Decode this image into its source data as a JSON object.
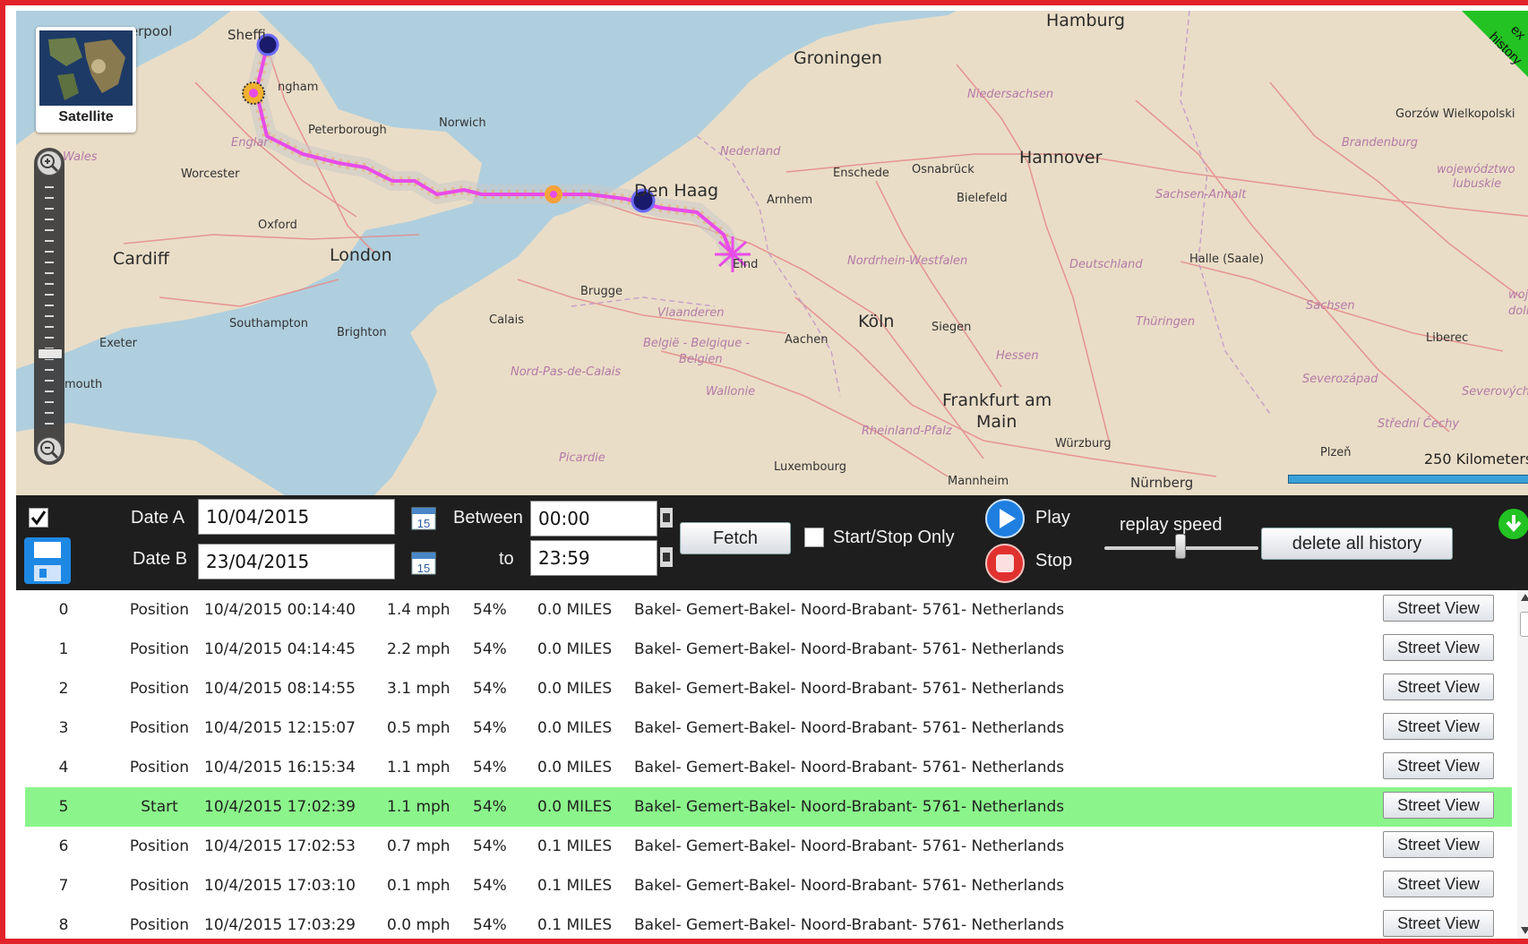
{
  "colors": {
    "frame_border": "#e2232a",
    "route_line": "#e84ce8",
    "toolbar_bg": "#1e1e1e",
    "highlight_row": "#8bf58b",
    "ribbon_green": "#22c322",
    "play_blue": "#1e7fe0",
    "stop_red": "#e0312f"
  },
  "map": {
    "satellite_label": "Satellite",
    "ribbon_text": [
      "ex",
      "history"
    ],
    "scale_label": "250 Kilometers",
    "places": {
      "liverpool": "verpool",
      "sheffield": "Sheffi",
      "nottingham": "ngham",
      "peterborough": "Peterborough",
      "norwich": "Norwich",
      "worcester": "Worcester",
      "oxford": "Oxford",
      "cardiff": "Cardiff",
      "london": "London",
      "southampton": "Southampton",
      "brighton": "Brighton",
      "exeter": "Exeter",
      "plymouth": "mouth",
      "groningen": "Groningen",
      "den_haag": "Den Haag",
      "arnhem": "Arnhem",
      "enschede": "Enschede",
      "osnabruck": "Osnabrück",
      "hannover": "Hannover",
      "bielefeld": "Bielefeld",
      "gorzow": "Gorzów Wielkopolski",
      "eindhoven": "Eind",
      "brugge": "Brugge",
      "calais": "Calais",
      "koln": "Köln",
      "aachen": "Aachen",
      "siegen": "Siegen",
      "halle": "Halle (Saale)",
      "frankfurt1": "Frankfurt am",
      "frankfurt2": "Main",
      "wurzburg": "Würzburg",
      "luxembourg": "Luxembourg",
      "mannheim": "Mannheim",
      "nurnberg": "Nürnberg",
      "plzen": "Plzeň",
      "liberec": "Liberec",
      "hamburg": "Hamburg"
    },
    "regions": {
      "wales": "Wales",
      "england": "Englar",
      "nederland": "Nederland",
      "niedersachsen": "Niedersachsen",
      "brandenburg": "Brandenburg",
      "sachsen_anhalt": "Sachsen-Anhalt",
      "nrw": "Nordrhein-Westfalen",
      "deutschland": "Deutschland",
      "vlaanderen": "Vlaanderen",
      "belgie1": "België - Belgique -",
      "belgie2": "Belgien",
      "nord_pas": "Nord-Pas-de-Calais",
      "wallonie": "Wallonie",
      "hessen": "Hessen",
      "thuringen": "Thüringen",
      "sachsen": "Sachsen",
      "rheinland": "Rheinland-Pfalz",
      "picardie": "Picardie",
      "severozapad": "Severozápad",
      "stredni": "Střední Čechy",
      "lubuskie1": "województwo",
      "lubuskie2": "lubuskie",
      "severovych": "Severovýcho",
      "wojew2": "woje",
      "dolny": "doln"
    }
  },
  "toolbar": {
    "date_a_label": "Date A",
    "date_a_value": "10/04/2015",
    "date_b_label": "Date B",
    "date_b_value": "23/04/2015",
    "calendar_day": "15",
    "between_label": "Between",
    "time_from": "00:00",
    "to_label": "to",
    "time_to": "23:59",
    "fetch_label": "Fetch",
    "start_stop_label": "Start/Stop Only",
    "play_label": "Play",
    "stop_label": "Stop",
    "replay_speed_label": "replay speed",
    "replay_speed_fraction": 0.5,
    "delete_label": "delete all history"
  },
  "table": {
    "street_view_label": "Street View",
    "highlighted_index": 5,
    "rows": [
      {
        "idx": "0",
        "type": "Position",
        "time": "10/4/2015 00:14:40",
        "speed": "1.4 mph",
        "battery": "54%",
        "distance": "0.0 MILES",
        "address": "Bakel- Gemert-Bakel- Noord-Brabant- 5761- Netherlands"
      },
      {
        "idx": "1",
        "type": "Position",
        "time": "10/4/2015 04:14:45",
        "speed": "2.2 mph",
        "battery": "54%",
        "distance": "0.0 MILES",
        "address": "Bakel- Gemert-Bakel- Noord-Brabant- 5761- Netherlands"
      },
      {
        "idx": "2",
        "type": "Position",
        "time": "10/4/2015 08:14:55",
        "speed": "3.1 mph",
        "battery": "54%",
        "distance": "0.0 MILES",
        "address": "Bakel- Gemert-Bakel- Noord-Brabant- 5761- Netherlands"
      },
      {
        "idx": "3",
        "type": "Position",
        "time": "10/4/2015 12:15:07",
        "speed": "0.5 mph",
        "battery": "54%",
        "distance": "0.0 MILES",
        "address": "Bakel- Gemert-Bakel- Noord-Brabant- 5761- Netherlands"
      },
      {
        "idx": "4",
        "type": "Position",
        "time": "10/4/2015 16:15:34",
        "speed": "1.1 mph",
        "battery": "54%",
        "distance": "0.0 MILES",
        "address": "Bakel- Gemert-Bakel- Noord-Brabant- 5761- Netherlands"
      },
      {
        "idx": "5",
        "type": "Start",
        "time": "10/4/2015 17:02:39",
        "speed": "1.1 mph",
        "battery": "54%",
        "distance": "0.0 MILES",
        "address": "Bakel- Gemert-Bakel- Noord-Brabant- 5761- Netherlands"
      },
      {
        "idx": "6",
        "type": "Position",
        "time": "10/4/2015 17:02:53",
        "speed": "0.7 mph",
        "battery": "54%",
        "distance": "0.1 MILES",
        "address": "Bakel- Gemert-Bakel- Noord-Brabant- 5761- Netherlands"
      },
      {
        "idx": "7",
        "type": "Position",
        "time": "10/4/2015 17:03:10",
        "speed": "0.1 mph",
        "battery": "54%",
        "distance": "0.1 MILES",
        "address": "Bakel- Gemert-Bakel- Noord-Brabant- 5761- Netherlands"
      },
      {
        "idx": "8",
        "type": "Position",
        "time": "10/4/2015 17:03:29",
        "speed": "0.0 mph",
        "battery": "54%",
        "distance": "0.1 MILES",
        "address": "Bakel- Gemert-Bakel- Noord-Brabant- 5761- Netherlands"
      }
    ]
  }
}
